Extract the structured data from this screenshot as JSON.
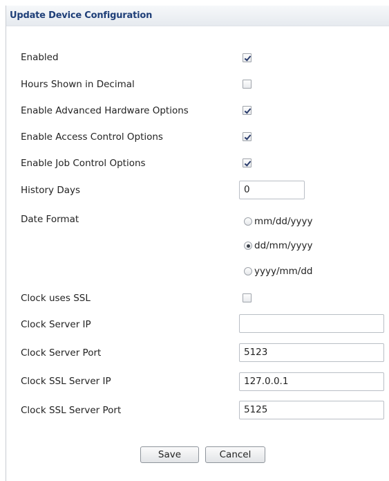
{
  "panel": {
    "title": "Update Device Configuration"
  },
  "form": {
    "enabled": {
      "label": "Enabled",
      "checked": true
    },
    "hours_decimal": {
      "label": "Hours Shown in Decimal",
      "checked": false
    },
    "advanced_hardware": {
      "label": "Enable Advanced Hardware Options",
      "checked": true
    },
    "access_control": {
      "label": "Enable Access Control Options",
      "checked": true
    },
    "job_control": {
      "label": "Enable Job Control Options",
      "checked": true
    },
    "history_days": {
      "label": "History Days",
      "value": "0"
    },
    "date_format": {
      "label": "Date Format",
      "options": [
        {
          "label": "mm/dd/yyyy",
          "selected": false
        },
        {
          "label": "dd/mm/yyyy",
          "selected": true
        },
        {
          "label": "yyyy/mm/dd",
          "selected": false
        }
      ]
    },
    "clock_ssl": {
      "label": "Clock uses SSL",
      "checked": false
    },
    "clock_server_ip": {
      "label": "Clock Server IP",
      "value": ""
    },
    "clock_server_port": {
      "label": "Clock Server Port",
      "value": "5123"
    },
    "clock_ssl_server_ip": {
      "label": "Clock SSL Server IP",
      "value": "127.0.0.1"
    },
    "clock_ssl_server_port": {
      "label": "Clock SSL Server Port",
      "value": "5125"
    }
  },
  "buttons": {
    "save_label": "Save",
    "cancel_label": "Cancel"
  },
  "colors": {
    "title": "#1f3f78",
    "header_bg": "#e6eaef",
    "checkmark": "#2a3c6c",
    "text": "#222222"
  }
}
